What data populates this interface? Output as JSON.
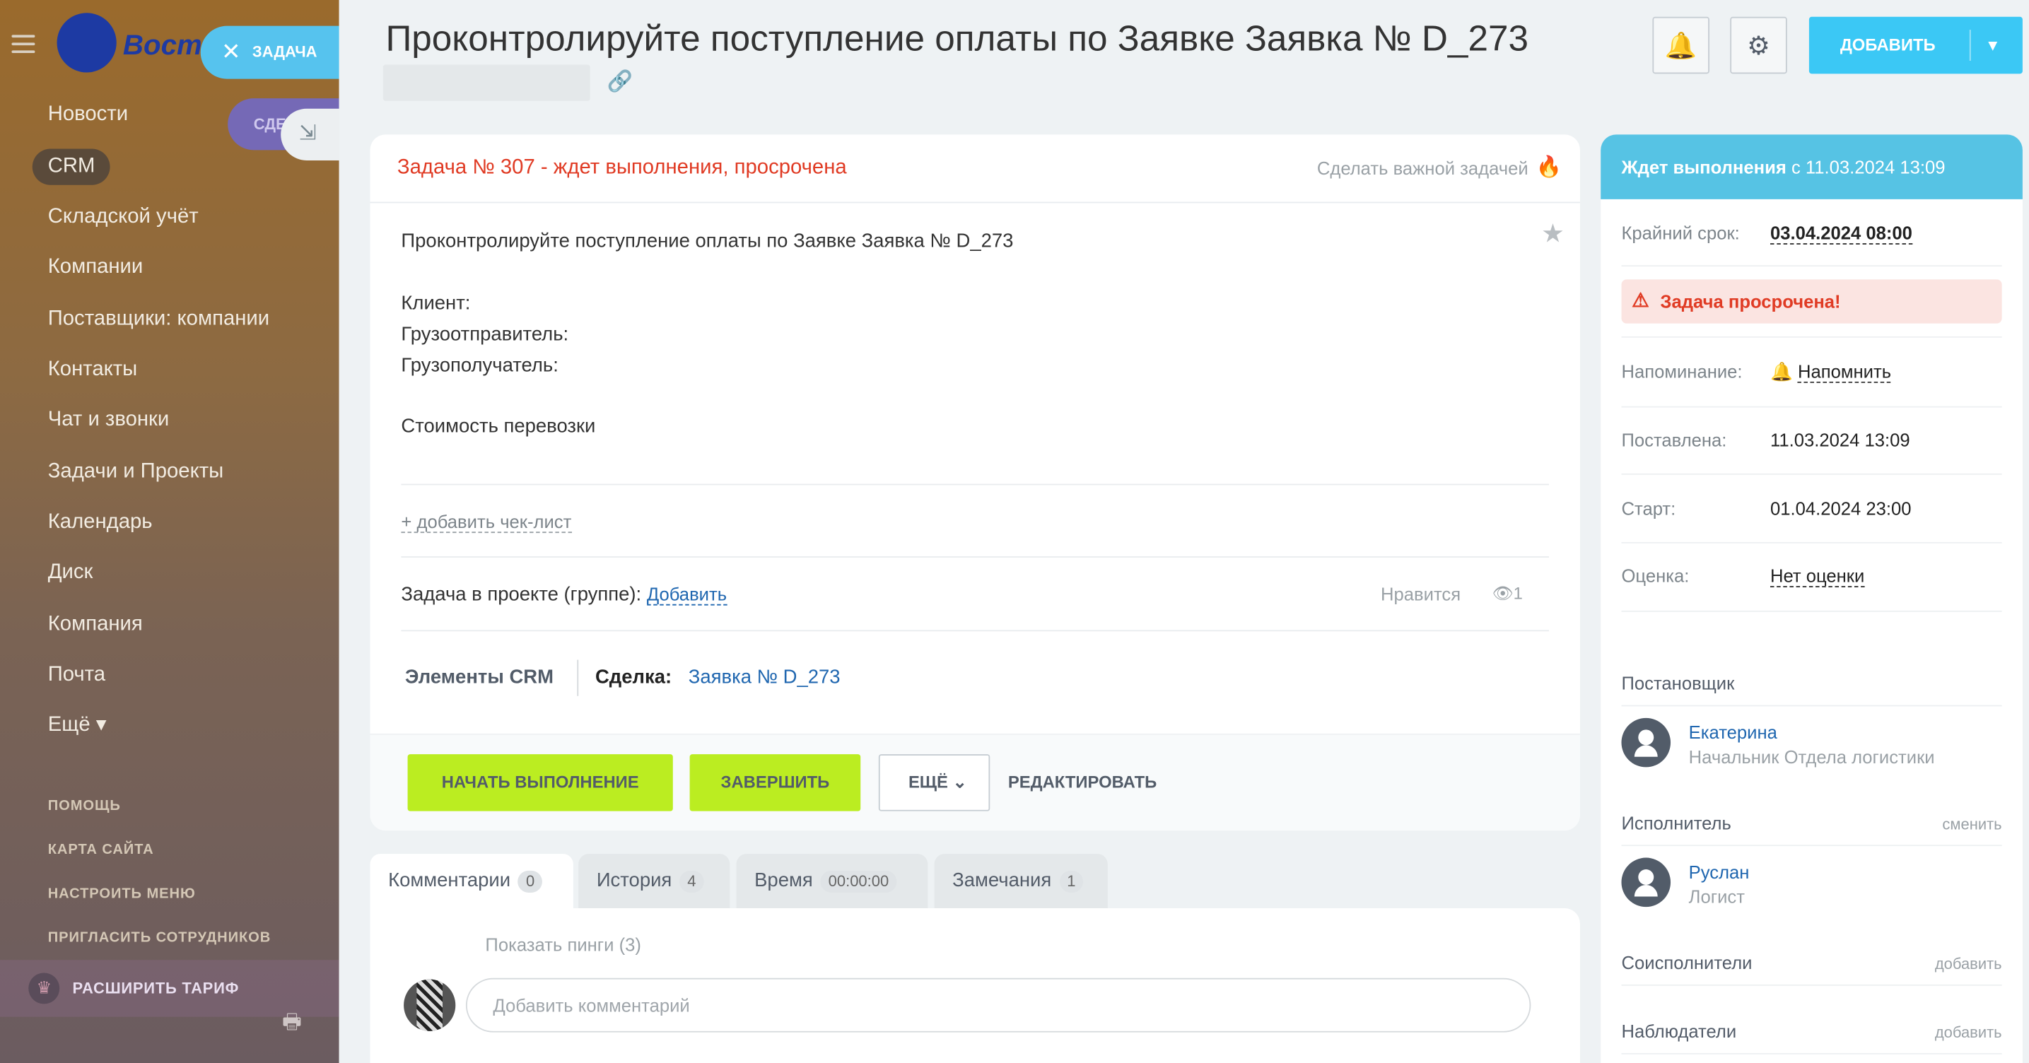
{
  "sidebar": {
    "logo_text": "Восток",
    "task_chip": "ЗАДАЧА",
    "sd_chip": "СДЕ",
    "items": [
      "Новости",
      "CRM",
      "Складской учёт",
      "Компании",
      "Поставщики: компании",
      "Контакты",
      "Чат и звонки",
      "Задачи и Проекты",
      "Календарь",
      "Диск",
      "Компания",
      "Почта",
      "Ещё ▾"
    ],
    "small_links": [
      "ПОМОЩЬ",
      "КАРТА САЙТА",
      "НАСТРОИТЬ МЕНЮ",
      "ПРИГЛАСИТЬ СОТРУДНИКОВ"
    ],
    "upgrade": "РАСШИРИТЬ ТАРИФ"
  },
  "header": {
    "title": "Проконтролируйте поступление оплаты по Заявке Заявка № D_273",
    "add_button": "ДОБАВИТЬ"
  },
  "task": {
    "status_line": "Задача № 307 - ждет выполнения, просрочена",
    "make_important": "Сделать важной задачей",
    "description": {
      "line1": "Проконтролируйте поступление оплаты по Заявке Заявка № D_273",
      "client": "Клиент:",
      "shipper": "Грузоотправитель:",
      "consignee": "Грузополучатель:",
      "cost": "Стоимость перевозки"
    },
    "add_checklist": "+ добавить чек-лист",
    "project_label": "Задача в проекте (группе):",
    "project_add": "Добавить",
    "likes": "Нравится",
    "views": "1",
    "crm_elements": "Элементы CRM",
    "deal_label": "Сделка:",
    "deal_link": "Заявка № D_273",
    "buttons": {
      "start": "НАЧАТЬ ВЫПОЛНЕНИЕ",
      "finish": "ЗАВЕРШИТЬ",
      "more": "ЕЩЁ",
      "edit": "РЕДАКТИРОВАТЬ"
    }
  },
  "tabs": [
    {
      "label": "Комментарии",
      "count": "0"
    },
    {
      "label": "История",
      "count": "4"
    },
    {
      "label": "Время",
      "count": "00:00:00"
    },
    {
      "label": "Замечания",
      "count": "1"
    }
  ],
  "comments": {
    "show_pings": "Показать пинги (3)",
    "placeholder": "Добавить комментарий"
  },
  "side": {
    "status_bold": "Ждет выполнения",
    "status_rest": " с 11.03.2024 13:09",
    "deadline_label": "Крайний срок:",
    "deadline_value": "03.04.2024 08:00",
    "overdue": "Задача просрочена!",
    "reminder_label": "Напоминание:",
    "reminder_value": "Напомнить",
    "created_label": "Поставлена:",
    "created_value": "11.03.2024 13:09",
    "start_label": "Старт:",
    "start_value": "01.04.2024 23:00",
    "rating_label": "Оценка:",
    "rating_value": "Нет оценки",
    "creator_title": "Постановщик",
    "creator_name": "Екатерина",
    "creator_pos": "Начальник Отдела логистики",
    "assignee_title": "Исполнитель",
    "assignee_change": "сменить",
    "assignee_name": "Руслан",
    "assignee_pos": "Логист",
    "coexec_title": "Соисполнители",
    "coexec_add": "добавить",
    "observers_title": "Наблюдатели",
    "observers_add": "добавить"
  }
}
